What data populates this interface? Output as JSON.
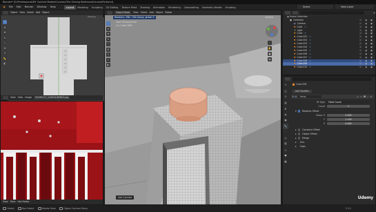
{
  "window": {
    "title": "Blender* [D:\\Professional\\MY Content Models\\Courses\\The Shining Bathroom\\Course\\Fb.blend]"
  },
  "menu": [
    "File",
    "Edit",
    "Render",
    "Window",
    "Help"
  ],
  "workspaces": [
    "Layout",
    "Modeling",
    "Sculpting",
    "UV Editing",
    "Texture Paint",
    "Shading",
    "Animation",
    "Rendering",
    "Compositing",
    "Geometry Nodes",
    "Scripting"
  ],
  "active_workspace": "Layout",
  "scene": {
    "name": "Scene"
  },
  "view_layer": {
    "name": "View Layer"
  },
  "top_viewport": {
    "header": [
      "Object",
      "View",
      "Select",
      "Add",
      "Object"
    ],
    "info_line1": "Top Orthographic",
    "info_line2": "(1) Cube.056",
    "options": "Options",
    "footer_header": [
      "View",
      "View",
      "Image"
    ],
    "image_name": "20190117_144924/4896/3.jpg"
  },
  "photo_footer": {
    "items": [
      "View",
      "Tools",
      "Use Nodes"
    ]
  },
  "main_viewport": {
    "mode": "Object Mode",
    "header": [
      "View",
      "Select",
      "Add",
      "Object"
    ],
    "transform": "Global",
    "title_bar": "Rotation: 296 / 180   Along: global X",
    "info_line1": "User Perspective",
    "info_line2": "(1) Cube.056",
    "options": "Options",
    "bottom_label": "Add Cylinder"
  },
  "outliner": {
    "header_search": "",
    "collection_root": "Scene Collection",
    "items": [
      {
        "name": "Collection",
        "type": "collection",
        "state": "normal"
      },
      {
        "name": "Camera",
        "type": "camera",
        "state": "normal"
      },
      {
        "name": "Cube",
        "type": "mesh",
        "state": "normal"
      },
      {
        "name": "Light",
        "type": "light",
        "state": "normal"
      },
      {
        "name": "Cube",
        "type": "mesh",
        "state": "normal"
      },
      {
        "name": "Cube.001",
        "type": "mesh",
        "state": "normal"
      },
      {
        "name": "Cube.002",
        "type": "mesh",
        "state": "normal"
      },
      {
        "name": "Cube.003",
        "type": "mesh",
        "state": "normal"
      },
      {
        "name": "Cube.004",
        "type": "mesh",
        "state": "normal"
      },
      {
        "name": "Cube.005",
        "type": "mesh",
        "state": "normal"
      },
      {
        "name": "Cube.006",
        "type": "mesh",
        "state": "normal"
      },
      {
        "name": "Cube.007",
        "type": "mesh",
        "state": "normal"
      },
      {
        "name": "Cube.008",
        "type": "mesh",
        "state": "selected"
      },
      {
        "name": "Cube.009",
        "type": "mesh",
        "state": "active"
      },
      {
        "name": "Cube.010",
        "type": "mesh",
        "state": "normal"
      }
    ]
  },
  "properties": {
    "object_name": "Cube.056",
    "add_modifier": "Add Modifier",
    "modifier_name": "Array",
    "fit_type_label": "Fit Type",
    "fit_type_value": "Fixed Count",
    "count_label": "Count",
    "count_value": "2",
    "relative_offset_label": "Relative Offset",
    "factor_x_label": "Factor X",
    "factor_x_value": "0.000",
    "y_label": "Y",
    "y_value": "1.109",
    "z_label": "Z",
    "z_value": "0.000",
    "panels": [
      "Constant Offset",
      "Object Offset",
      "Merge",
      "UVs",
      "Caps"
    ]
  },
  "status_bar": {
    "items": [
      "Select",
      "Box Select",
      "Rotate View",
      "Object Context Menu"
    ],
    "version": "3.3.1"
  },
  "watermark": "Udemy",
  "colors": {
    "accent": "#4772b3",
    "active_tab": "#e88a2e",
    "red_wall": "#8a0f14",
    "cylinder": "#e3a88c"
  }
}
